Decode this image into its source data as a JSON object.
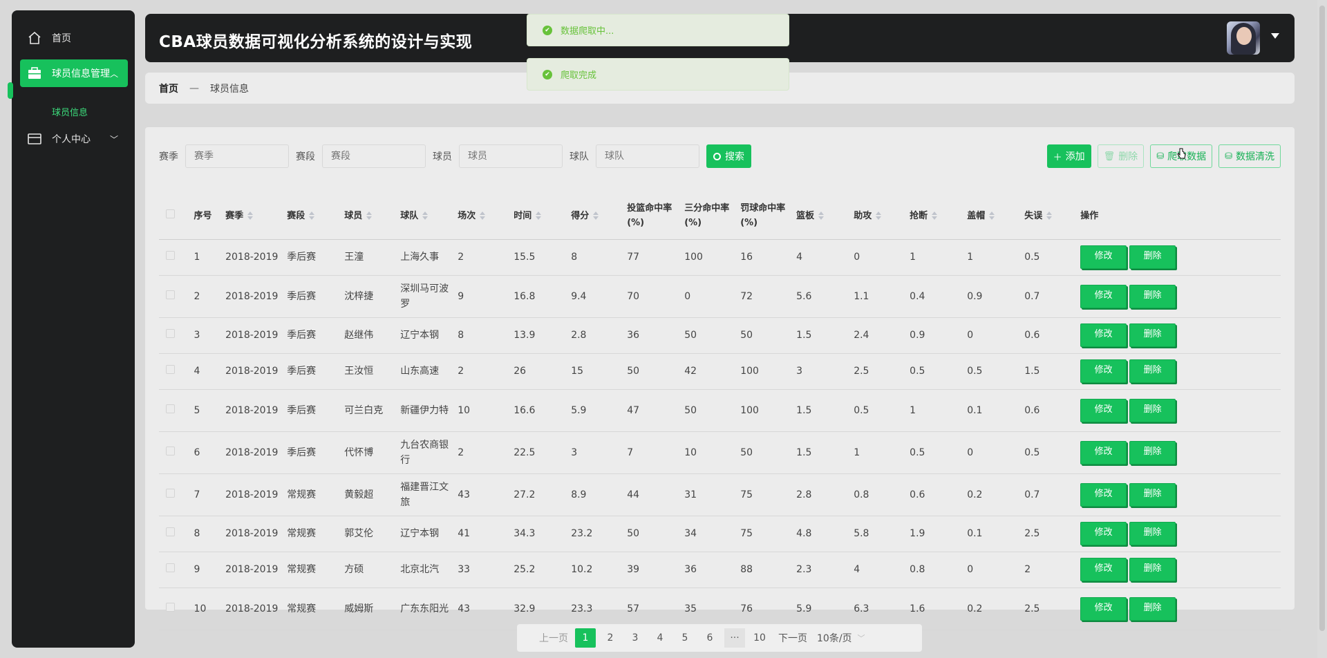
{
  "sidebar": {
    "items": [
      {
        "label": "首页",
        "icon": "home-icon"
      },
      {
        "label": "球员信息管理",
        "icon": "briefcase-icon",
        "active": true
      },
      {
        "label": "个人中心",
        "icon": "wallet-icon"
      }
    ],
    "sub_item": "球员信息"
  },
  "header": {
    "title": "CBA球员数据可视化分析系统的设计与实现"
  },
  "breadcrumb": {
    "home": "首页",
    "separator": "—",
    "current": "球员信息"
  },
  "toasts": [
    "数据爬取中...",
    "爬取完成"
  ],
  "search": {
    "season_label": "赛季",
    "season_placeholder": "赛季",
    "stage_label": "赛段",
    "stage_placeholder": "赛段",
    "player_label": "球员",
    "player_placeholder": "球员",
    "team_label": "球队",
    "team_placeholder": "球队",
    "button": "搜索"
  },
  "toolbar": {
    "add": "添加",
    "delete": "删除",
    "crawl": "爬取数据",
    "clean": "数据清洗"
  },
  "table": {
    "headers": [
      "序号",
      "赛季",
      "赛段",
      "球员",
      "球队",
      "场次",
      "时间",
      "得分",
      "投篮命中率(%)",
      "三分命中率(%)",
      "罚球命中率(%)",
      "篮板",
      "助攻",
      "抢断",
      "盖帽",
      "失误",
      "操作"
    ],
    "edit_label": "修改",
    "delete_label": "删除",
    "rows": [
      [
        "1",
        "2018-2019",
        "季后赛",
        "王潼",
        "上海久事",
        "2",
        "15.5",
        "8",
        "77",
        "100",
        "16",
        "4",
        "0",
        "1",
        "1",
        "0.5"
      ],
      [
        "2",
        "2018-2019",
        "季后赛",
        "沈梓捷",
        "深圳马可波罗",
        "9",
        "16.8",
        "9.4",
        "70",
        "0",
        "72",
        "5.6",
        "1.1",
        "0.4",
        "0.9",
        "0.7"
      ],
      [
        "3",
        "2018-2019",
        "季后赛",
        "赵继伟",
        "辽宁本钢",
        "8",
        "13.9",
        "2.8",
        "36",
        "50",
        "50",
        "1.5",
        "2.4",
        "0.9",
        "0",
        "0.6"
      ],
      [
        "4",
        "2018-2019",
        "季后赛",
        "王汝恒",
        "山东高速",
        "2",
        "26",
        "15",
        "50",
        "42",
        "100",
        "3",
        "2.5",
        "0.5",
        "0.5",
        "1.5"
      ],
      [
        "5",
        "2018-2019",
        "季后赛",
        "可兰白克",
        "新疆伊力特",
        "10",
        "16.6",
        "5.9",
        "47",
        "50",
        "100",
        "1.5",
        "0.5",
        "1",
        "0.1",
        "0.6"
      ],
      [
        "6",
        "2018-2019",
        "季后赛",
        "代怀博",
        "九台农商银行",
        "2",
        "22.5",
        "3",
        "7",
        "10",
        "50",
        "1.5",
        "1",
        "0.5",
        "0",
        "0.5"
      ],
      [
        "7",
        "2018-2019",
        "常规赛",
        "黄毅超",
        "福建晋江文旅",
        "43",
        "27.2",
        "8.9",
        "44",
        "31",
        "75",
        "2.8",
        "0.8",
        "0.6",
        "0.2",
        "0.7"
      ],
      [
        "8",
        "2018-2019",
        "常规赛",
        "郭艾伦",
        "辽宁本钢",
        "41",
        "34.3",
        "23.2",
        "50",
        "34",
        "75",
        "4.8",
        "5.8",
        "1.9",
        "0.1",
        "2.5"
      ],
      [
        "9",
        "2018-2019",
        "常规赛",
        "方硕",
        "北京北汽",
        "33",
        "25.2",
        "10.2",
        "39",
        "36",
        "88",
        "2.3",
        "4",
        "0.8",
        "0",
        "2"
      ],
      [
        "10",
        "2018-2019",
        "常规赛",
        "威姆斯",
        "广东东阳光",
        "43",
        "32.9",
        "23.3",
        "57",
        "35",
        "76",
        "5.9",
        "6.3",
        "1.6",
        "0.2",
        "2.5"
      ]
    ]
  },
  "pager": {
    "prev": "上一页",
    "pages": [
      "1",
      "2",
      "3",
      "4",
      "5",
      "6"
    ],
    "more": "···",
    "last": "10",
    "next": "下一页",
    "size": "10条/页",
    "current": 1
  },
  "colors": {
    "accent": "#17c15c",
    "dark": "#1e1f20",
    "toast_text": "#67c23a"
  }
}
